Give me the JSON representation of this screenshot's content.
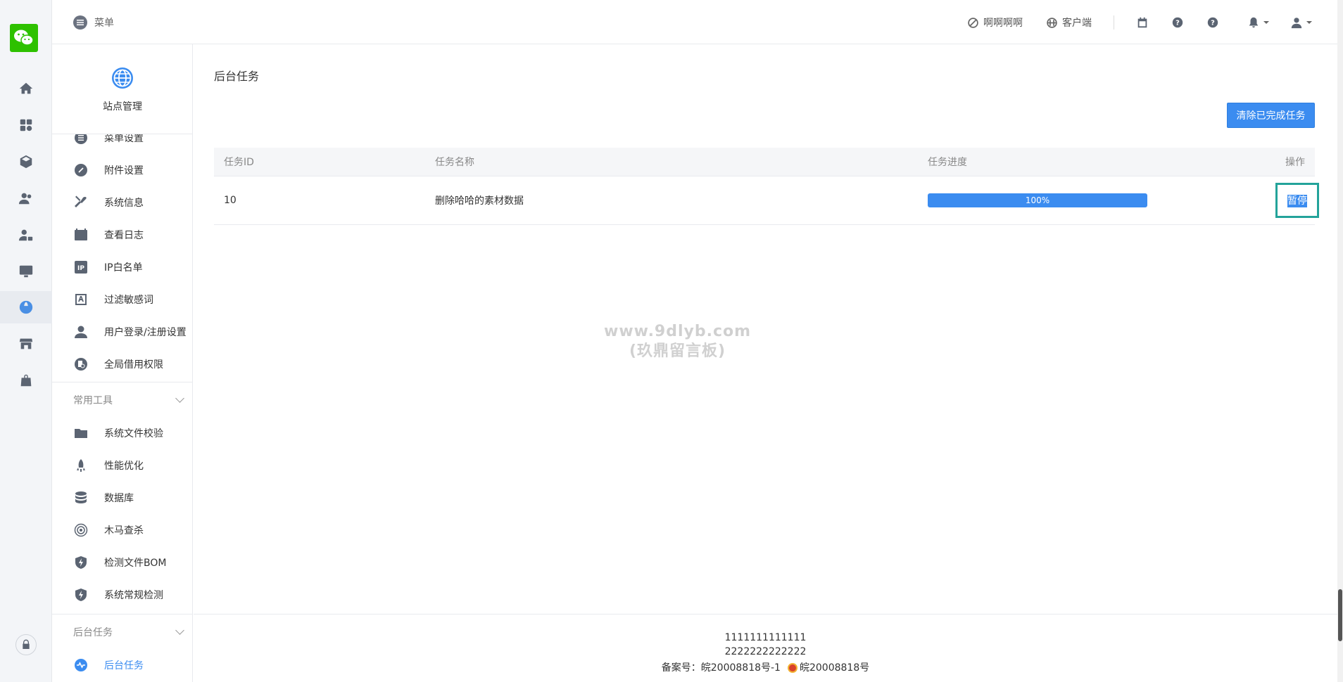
{
  "header": {
    "menu_label": "菜单",
    "links": [
      {
        "label": "啊啊啊啊",
        "icon": "ban-icon"
      },
      {
        "label": "客户端",
        "icon": "apps-grid-icon"
      }
    ],
    "icons": [
      "calendar-icon",
      "help-icon",
      "question-icon",
      "bell-icon",
      "user-icon"
    ]
  },
  "rail": {
    "icons": [
      "home-icon",
      "apps-icon",
      "cube-icon",
      "users-icon",
      "user-lock-icon",
      "monitor-icon",
      "globe-icon",
      "store-icon",
      "bag-icon",
      "lock-icon"
    ],
    "active": "globe-icon"
  },
  "sidebar": {
    "site_title": "站点管理",
    "items": [
      {
        "label": "菜单设置",
        "icon": "list-icon"
      },
      {
        "label": "附件设置",
        "icon": "link-icon"
      },
      {
        "label": "系统信息",
        "icon": "wrench-icon"
      },
      {
        "label": "查看日志",
        "icon": "log-icon"
      },
      {
        "label": "IP白名单",
        "icon": "ip-icon"
      },
      {
        "label": "过滤敏感词",
        "icon": "filter-icon"
      },
      {
        "label": "用户登录/注册设置",
        "icon": "user-icon"
      },
      {
        "label": "全局借用权限",
        "icon": "permission-icon"
      }
    ],
    "group_tools": "常用工具",
    "tools": [
      {
        "label": "系统文件校验",
        "icon": "folder-icon"
      },
      {
        "label": "性能优化",
        "icon": "rocket-icon"
      },
      {
        "label": "数据库",
        "icon": "database-icon"
      },
      {
        "label": "木马查杀",
        "icon": "target-icon"
      },
      {
        "label": "检测文件BOM",
        "icon": "shield-bolt-icon"
      },
      {
        "label": "系统常规检测",
        "icon": "shield-bolt-icon"
      }
    ],
    "group_tasks": "后台任务",
    "task_item": {
      "label": "后台任务",
      "icon": "pulse-icon"
    }
  },
  "main": {
    "title": "后台任务",
    "clear_button": "清除已完成任务",
    "columns": {
      "id": "任务ID",
      "name": "任务名称",
      "progress": "任务进度",
      "op": "操作"
    },
    "rows": [
      {
        "id": "10",
        "name": "删除哈哈的素材数据",
        "progress": 1.0,
        "progress_label": "100%",
        "action": "暂停"
      }
    ],
    "accent": "#3b8cf0"
  },
  "watermark": {
    "line1": "www.9dlyb.com",
    "line2": "(玖鼎留言板)"
  },
  "footer": {
    "line1": "1111111111111",
    "line2": "2222222222222",
    "icp": "备案号：皖20008818号-1",
    "police": "皖20008818号"
  }
}
